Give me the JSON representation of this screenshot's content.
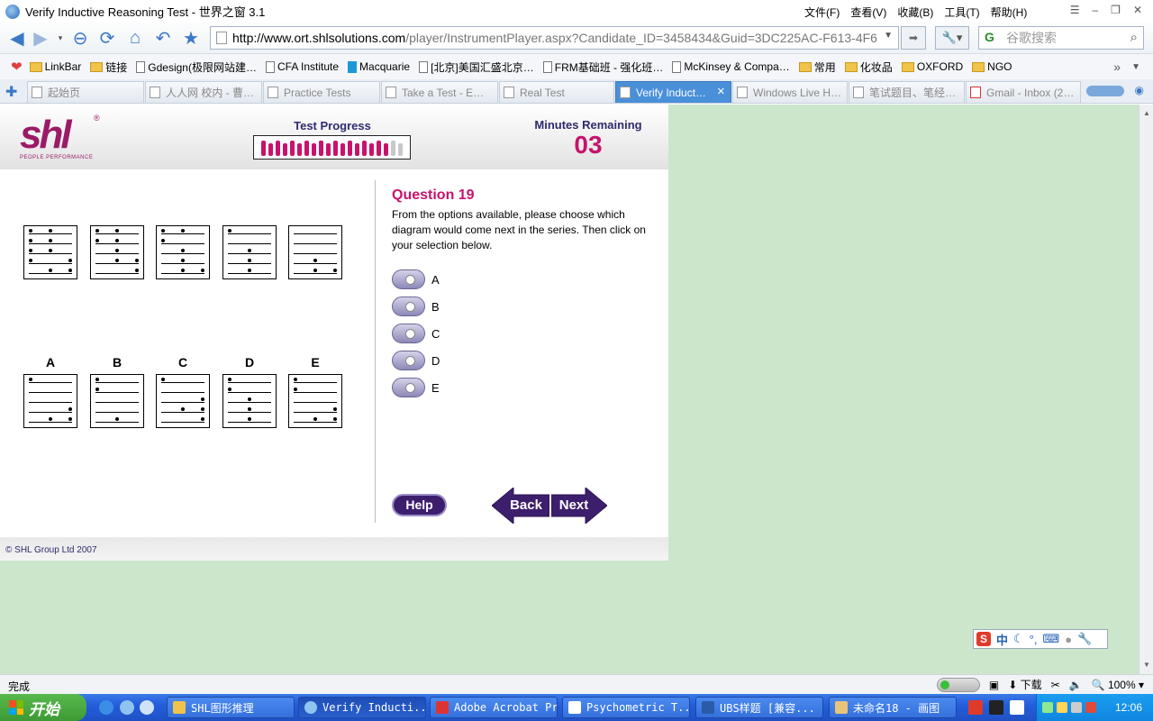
{
  "window": {
    "title": "Verify Inductive Reasoning Test - 世界之窗 3.1",
    "menus": [
      "文件(F)",
      "查看(V)",
      "收藏(B)",
      "工具(T)",
      "帮助(H)"
    ]
  },
  "navbar": {
    "url_domain": "http://www.ort.shlsolutions.com",
    "url_rest": "/player/InstrumentPlayer.aspx?Candidate_ID=3458434&Guid=3DC225AC-F613-4F6",
    "search_placeholder": "谷歌搜索"
  },
  "bookmarks": [
    {
      "label": "LinkBar",
      "type": "folder"
    },
    {
      "label": "链接",
      "type": "folder"
    },
    {
      "label": "Gdesign(极限网站建…",
      "type": "page"
    },
    {
      "label": "CFA Institute",
      "type": "page"
    },
    {
      "label": "Macquarie",
      "type": "page"
    },
    {
      "label": "[北京]美国汇盛北京…",
      "type": "page"
    },
    {
      "label": "FRM基础班 - 强化班…",
      "type": "page"
    },
    {
      "label": "McKinsey & Compa…",
      "type": "page"
    },
    {
      "label": "常用",
      "type": "folder"
    },
    {
      "label": "化妆品",
      "type": "folder"
    },
    {
      "label": "OXFORD",
      "type": "folder"
    },
    {
      "label": "NGO",
      "type": "folder"
    }
  ],
  "tabs": [
    {
      "label": "起始页",
      "active": false
    },
    {
      "label": "人人网 校内 - 曹…",
      "active": false
    },
    {
      "label": "Practice Tests",
      "active": false
    },
    {
      "label": "Take a Test - E…",
      "active": false
    },
    {
      "label": "Real Test",
      "active": false
    },
    {
      "label": "Verify Induct…",
      "active": true
    },
    {
      "label": "Windows Live H…",
      "active": false
    },
    {
      "label": "笔试题目、笔经…",
      "active": false
    },
    {
      "label": "Gmail - Inbox (2…",
      "active": false
    }
  ],
  "player": {
    "logo_text": "shl",
    "logo_tagline": "PEOPLE PERFORMANCE",
    "progress_label": "Test Progress",
    "progress_fraction": 0.9,
    "progress_segments_total": 20,
    "progress_segments_done": 18,
    "minutes_label": "Minutes Remaining",
    "minutes_value": "03",
    "question_title": "Question 19",
    "question_text": "From the options available, please choose which diagram would come next in the series. Then click on your selection below.",
    "options": [
      "A",
      "B",
      "C",
      "D",
      "E"
    ],
    "help_label": "Help",
    "back_label": "Back",
    "next_label": "Next",
    "copyright": "© SHL Group Ltd 2007",
    "accent_color": "#c8126c",
    "brand_color": "#9b1a67",
    "button_color": "#3d1e6d"
  },
  "statusbar": {
    "text": "完成",
    "download_label": "下载",
    "zoom": "100%"
  },
  "taskbar": {
    "start_label": "开始",
    "tasks": [
      {
        "label": "SHL图形推理",
        "active": false
      },
      {
        "label": "Verify Inducti...",
        "active": true
      },
      {
        "label": "Adobe Acrobat Pro",
        "active": false
      },
      {
        "label": "Psychometric T...",
        "active": false
      },
      {
        "label": "UBS样题 [兼容...",
        "active": false
      },
      {
        "label": "未命名18 - 画图",
        "active": false
      }
    ],
    "clock": "12:06"
  },
  "ime": {
    "mode": "中"
  }
}
